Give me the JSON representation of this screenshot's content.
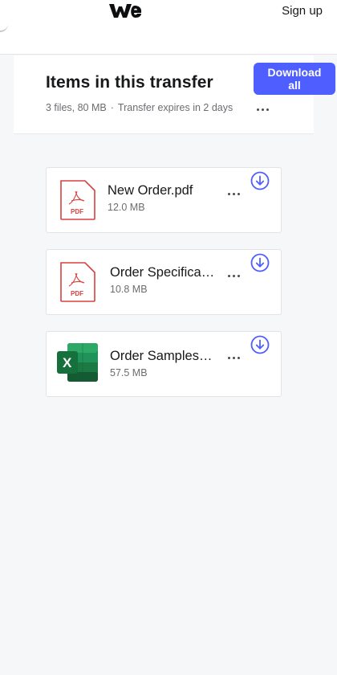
{
  "header": {
    "signup_label": "Sign up"
  },
  "transfer": {
    "title": "Items in this transfer",
    "file_count": "3 files, 80 MB",
    "separator": "·",
    "expiry": "Transfer expires in 2 days",
    "download_all_label": "Download all"
  },
  "files": [
    {
      "name": "New Order.pdf",
      "size": "12.0 MB",
      "icon": "pdf-icon",
      "icon_label": "PDF"
    },
    {
      "name": "Order Specifications.pdf",
      "size": "10.8 MB",
      "icon": "pdf-icon",
      "icon_label": "PDF"
    },
    {
      "name": "Order Samples.xlsx",
      "size": "57.5 MB",
      "icon": "excel-icon",
      "icon_label": "X"
    }
  ],
  "colors": {
    "accent": "#4f5fff",
    "pdf_red": "#d94040",
    "excel_green": "#1f7a43",
    "background": "#f6f7f9"
  }
}
